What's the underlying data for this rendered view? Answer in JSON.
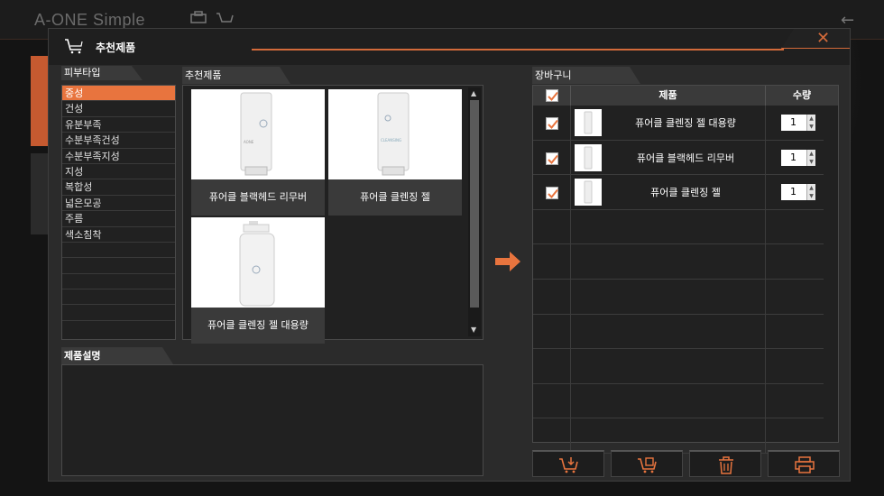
{
  "background": {
    "logo": "A-ONE Simple"
  },
  "dialog": {
    "title": "추천제품",
    "close_label": "✕"
  },
  "skin_type": {
    "tab_label": "피부타입",
    "items": [
      "중성",
      "건성",
      "유분부족",
      "수분부족건성",
      "수분부족지성",
      "지성",
      "복합성",
      "넓은모공",
      "주름",
      "색소침착",
      "",
      "",
      "",
      "",
      ""
    ],
    "selected_index": 0
  },
  "recommended": {
    "tab_label": "추천제품",
    "products": [
      {
        "name": "퓨어클 블랙헤드 리무버"
      },
      {
        "name": "퓨어클 클렌징 젤"
      },
      {
        "name": "퓨어클 클렌징 젤 대용량"
      }
    ]
  },
  "description": {
    "tab_label": "제품설명",
    "text": ""
  },
  "cart": {
    "tab_label": "장바구니",
    "columns": {
      "product": "제품",
      "quantity": "수량"
    },
    "items": [
      {
        "name": "퓨어클 클렌징 젤 대용량",
        "qty": "1",
        "checked": true
      },
      {
        "name": "퓨어클 블랙헤드 리무버",
        "qty": "1",
        "checked": true
      },
      {
        "name": "퓨어클 클렌징 젤",
        "qty": "1",
        "checked": true
      }
    ],
    "empty_rows": 7
  },
  "colors": {
    "accent": "#e8743e",
    "panel": "#212121",
    "dialog": "#2b2b2b"
  },
  "icons": {
    "add_to_cart": "cart-add-icon",
    "cart_remove": "cart-remove-icon",
    "delete": "trash-icon",
    "print": "printer-icon"
  }
}
